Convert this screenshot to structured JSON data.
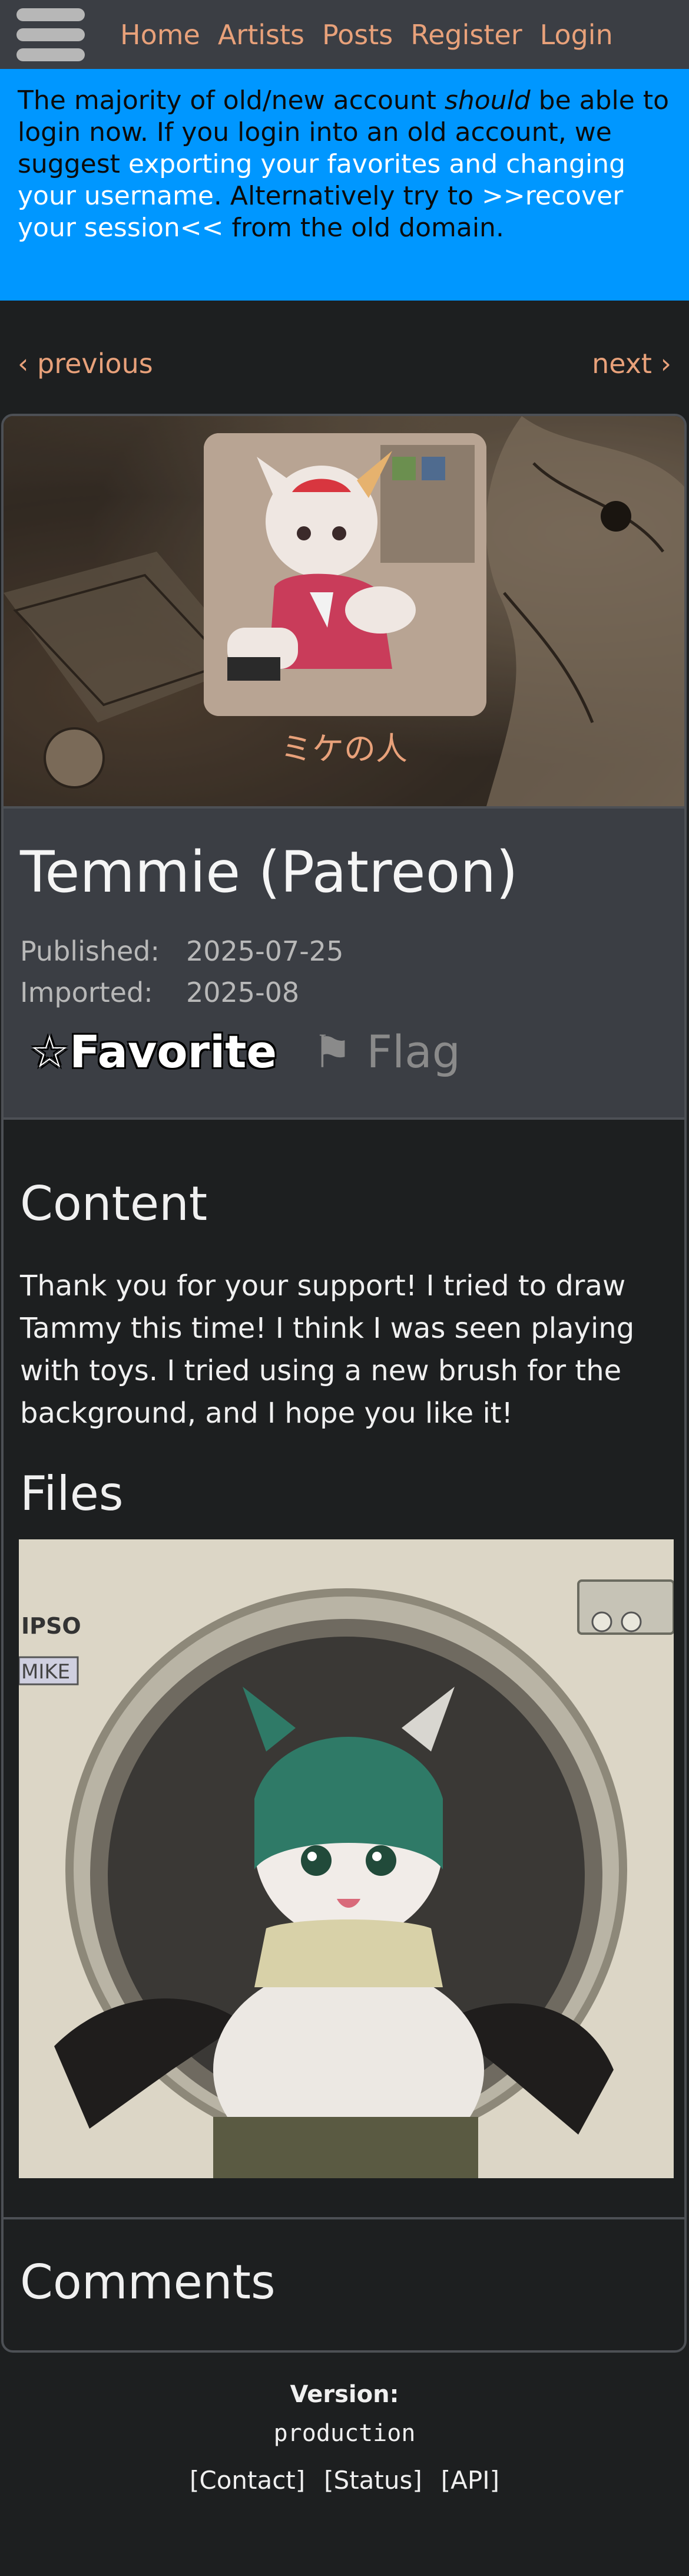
{
  "nav": {
    "items": [
      {
        "label": "Home"
      },
      {
        "label": "Artists"
      },
      {
        "label": "Posts"
      },
      {
        "label": "Register"
      },
      {
        "label": "Login"
      }
    ]
  },
  "announcement": {
    "t1": "The majority of old/new account ",
    "em": "should",
    "t2": " be able to login now. If you login into an old account, we suggest ",
    "link1": "exporting your favorites and changing your username",
    "t3": ". Alternatively try to ",
    "link2": ">>recover your session<<",
    "t4": " from the old domain."
  },
  "paginator": {
    "prev": "‹ previous",
    "next": "next ›"
  },
  "post": {
    "artist_name": "ミケの人",
    "title": "Temmie (Patreon)",
    "published_label": "Published:",
    "published_value": "2025-07-25",
    "imported_label": "Imported:",
    "imported_value": "2025-08",
    "favorite_label": "☆Favorite",
    "flag_label": "⚑ Flag",
    "content_heading": "Content",
    "content_text": "Thank you for your support! I tried to draw Tammy this time! I think I was seen playing with toys. I tried using a new brush for the background, and I hope you like it!",
    "files_heading": "Files",
    "comments_heading": "Comments"
  },
  "footer": {
    "version_label": "Version:",
    "version_value": "production",
    "links": [
      "[Contact]",
      "[Status]",
      "[API]"
    ]
  },
  "colors": {
    "nav_bg": "#3b3e44",
    "link": "#e8a17a",
    "announcement_bg": "#0097ff",
    "page_bg": "#1d1f20"
  }
}
